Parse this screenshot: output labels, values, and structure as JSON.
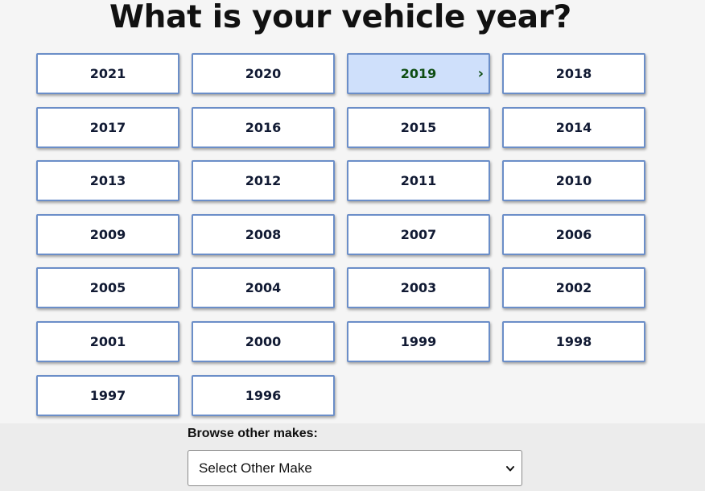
{
  "page": {
    "title": "What is your vehicle year?"
  },
  "years": [
    {
      "label": "2021",
      "selected": false
    },
    {
      "label": "2020",
      "selected": false
    },
    {
      "label": "2019",
      "selected": true
    },
    {
      "label": "2018",
      "selected": false
    },
    {
      "label": "2017",
      "selected": false
    },
    {
      "label": "2016",
      "selected": false
    },
    {
      "label": "2015",
      "selected": false
    },
    {
      "label": "2014",
      "selected": false
    },
    {
      "label": "2013",
      "selected": false
    },
    {
      "label": "2012",
      "selected": false
    },
    {
      "label": "2011",
      "selected": false
    },
    {
      "label": "2010",
      "selected": false
    },
    {
      "label": "2009",
      "selected": false
    },
    {
      "label": "2008",
      "selected": false
    },
    {
      "label": "2007",
      "selected": false
    },
    {
      "label": "2006",
      "selected": false
    },
    {
      "label": "2005",
      "selected": false
    },
    {
      "label": "2004",
      "selected": false
    },
    {
      "label": "2003",
      "selected": false
    },
    {
      "label": "2002",
      "selected": false
    },
    {
      "label": "2001",
      "selected": false
    },
    {
      "label": "2000",
      "selected": false
    },
    {
      "label": "1999",
      "selected": false
    },
    {
      "label": "1998",
      "selected": false
    },
    {
      "label": "1997",
      "selected": false
    },
    {
      "label": "1996",
      "selected": false
    }
  ],
  "selected_indicator_icon": "chevron-right-icon",
  "browse": {
    "label": "Browse other makes:",
    "select_value": "Select Other Make",
    "caret_icon": "chevron-down-icon"
  },
  "colors": {
    "button_border": "#6b8ec8",
    "selected_bg": "#cfe0fb",
    "selected_text": "#0d4d12"
  }
}
